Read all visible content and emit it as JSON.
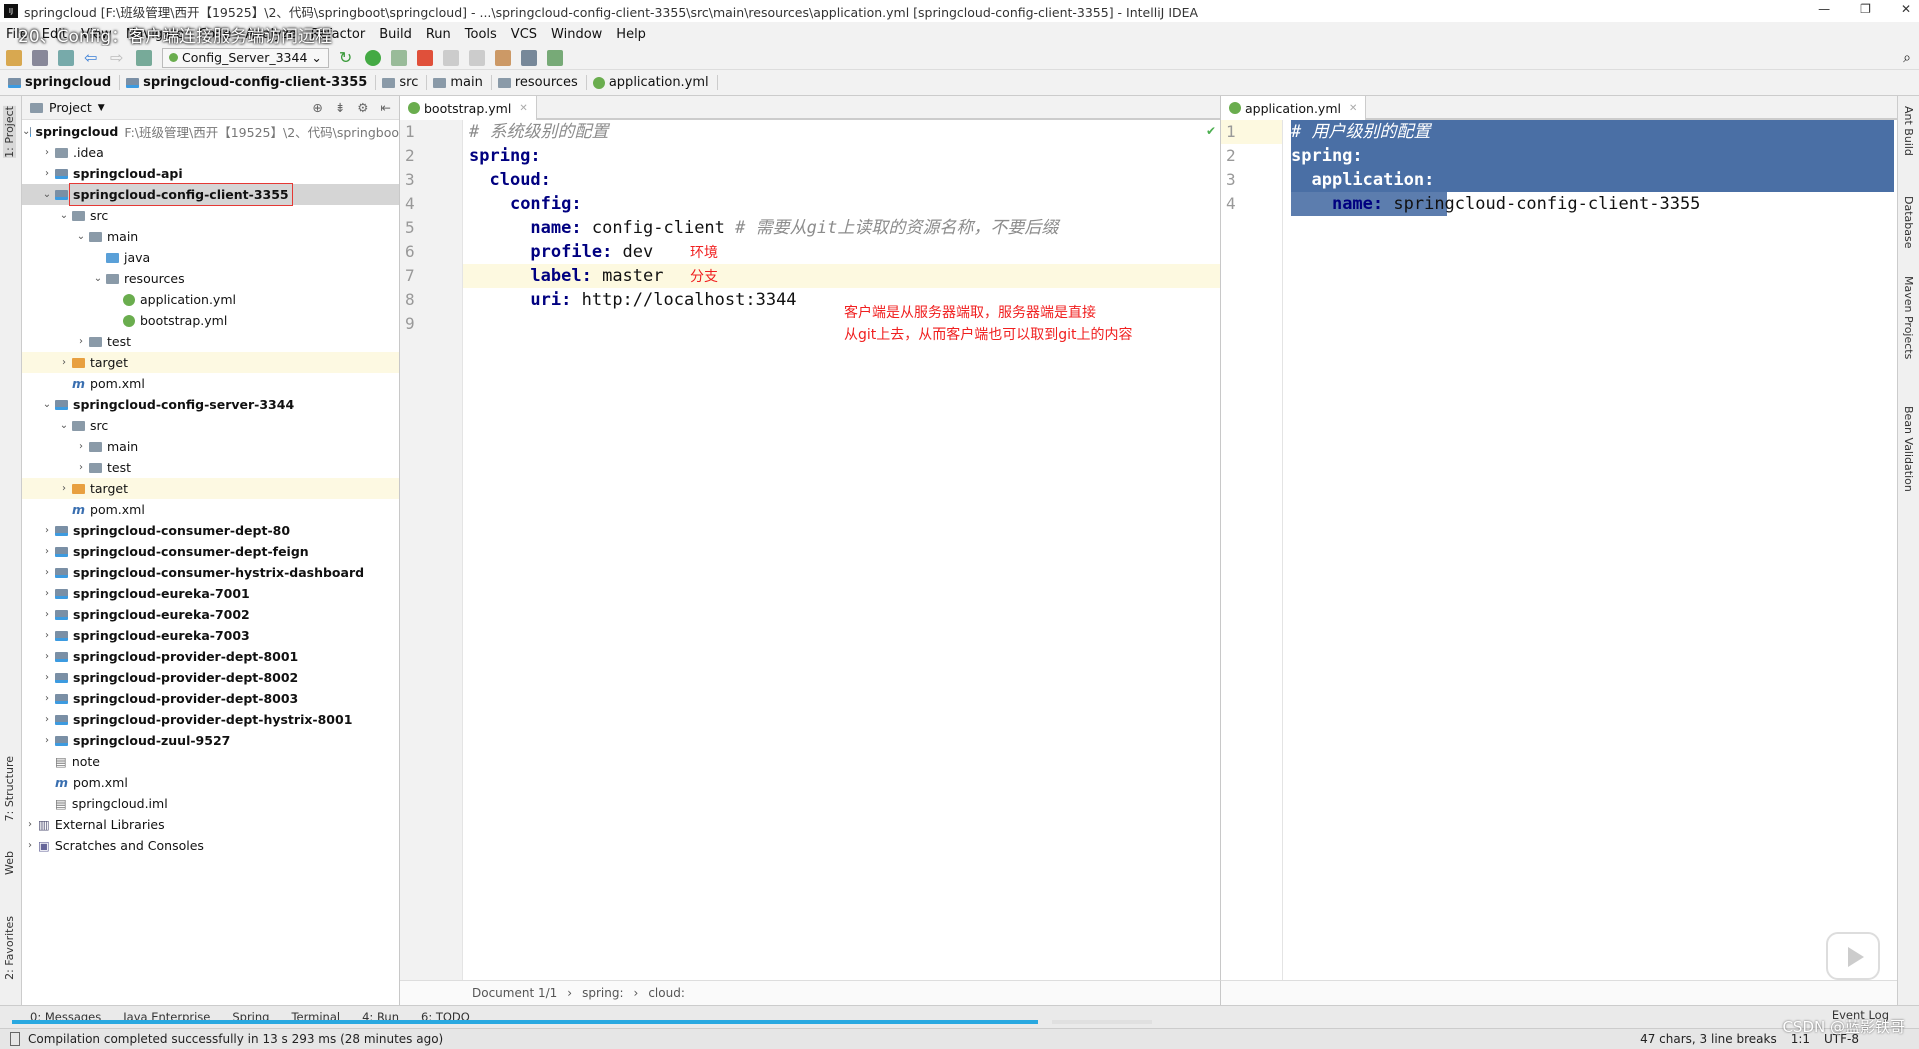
{
  "window": {
    "title": "springcloud [F:\\班级管理\\西开【19525】\\2、代码\\springboot\\springcloud] - ...\\springcloud-config-client-3355\\src\\main\\resources\\application.yml [springcloud-config-client-3355] - IntelliJ IDEA"
  },
  "video_title": "20、Config：客户端连接服务端访问远程",
  "menu": [
    "File",
    "Edit",
    "View",
    "Navigate",
    "Code",
    "Analyze",
    "Refactor",
    "Build",
    "Run",
    "Tools",
    "VCS",
    "Window",
    "Help"
  ],
  "toolbar": {
    "run_config": "Config_Server_3344"
  },
  "breadcrumb": [
    "springcloud",
    "springcloud-config-client-3355",
    "src",
    "main",
    "resources",
    "application.yml"
  ],
  "left_strip": [
    "1: Project",
    "7: Structure",
    "Web",
    "2: Favorites"
  ],
  "right_strip": [
    "Ant Build",
    "Database",
    "Maven Projects",
    "Bean Validation"
  ],
  "project": {
    "header": "Project",
    "tree": [
      {
        "d": 0,
        "label": "springcloud",
        "path": "F:\\班级管理\\西开【19525】\\2、代码\\springboo",
        "exp": true,
        "bold": true,
        "icon": "module"
      },
      {
        "d": 1,
        "label": ".idea",
        "icon": "folder"
      },
      {
        "d": 1,
        "label": "springcloud-api",
        "bold": true,
        "icon": "module"
      },
      {
        "d": 1,
        "label": "springcloud-config-client-3355",
        "bold": true,
        "exp": true,
        "icon": "module",
        "selected": true,
        "boxed": true
      },
      {
        "d": 2,
        "label": "src",
        "exp": true,
        "icon": "folder"
      },
      {
        "d": 3,
        "label": "main",
        "exp": true,
        "icon": "folder"
      },
      {
        "d": 4,
        "label": "java",
        "icon": "folder-blue",
        "leaf": true
      },
      {
        "d": 4,
        "label": "resources",
        "exp": true,
        "icon": "folder"
      },
      {
        "d": 5,
        "label": "application.yml",
        "icon": "yml",
        "leaf": true
      },
      {
        "d": 5,
        "label": "bootstrap.yml",
        "icon": "yml",
        "leaf": true
      },
      {
        "d": 3,
        "label": "test",
        "icon": "folder"
      },
      {
        "d": 2,
        "label": "target",
        "icon": "folder-orange",
        "hl": true
      },
      {
        "d": 2,
        "label": "pom.xml",
        "icon": "maven",
        "leaf": true
      },
      {
        "d": 1,
        "label": "springcloud-config-server-3344",
        "bold": true,
        "exp": true,
        "icon": "module"
      },
      {
        "d": 2,
        "label": "src",
        "exp": true,
        "icon": "folder"
      },
      {
        "d": 3,
        "label": "main",
        "icon": "folder"
      },
      {
        "d": 3,
        "label": "test",
        "icon": "folder"
      },
      {
        "d": 2,
        "label": "target",
        "icon": "folder-orange",
        "hl": true
      },
      {
        "d": 2,
        "label": "pom.xml",
        "icon": "maven",
        "leaf": true
      },
      {
        "d": 1,
        "label": "springcloud-consumer-dept-80",
        "bold": true,
        "icon": "module"
      },
      {
        "d": 1,
        "label": "springcloud-consumer-dept-feign",
        "bold": true,
        "icon": "module"
      },
      {
        "d": 1,
        "label": "springcloud-consumer-hystrix-dashboard",
        "bold": true,
        "icon": "module"
      },
      {
        "d": 1,
        "label": "springcloud-eureka-7001",
        "bold": true,
        "icon": "module"
      },
      {
        "d": 1,
        "label": "springcloud-eureka-7002",
        "bold": true,
        "icon": "module"
      },
      {
        "d": 1,
        "label": "springcloud-eureka-7003",
        "bold": true,
        "icon": "module"
      },
      {
        "d": 1,
        "label": "springcloud-provider-dept-8001",
        "bold": true,
        "icon": "module"
      },
      {
        "d": 1,
        "label": "springcloud-provider-dept-8002",
        "bold": true,
        "icon": "module"
      },
      {
        "d": 1,
        "label": "springcloud-provider-dept-8003",
        "bold": true,
        "icon": "module"
      },
      {
        "d": 1,
        "label": "springcloud-provider-dept-hystrix-8001",
        "bold": true,
        "icon": "module"
      },
      {
        "d": 1,
        "label": "springcloud-zuul-9527",
        "bold": true,
        "icon": "module"
      },
      {
        "d": 1,
        "label": "note",
        "icon": "file",
        "leaf": true
      },
      {
        "d": 1,
        "label": "pom.xml",
        "icon": "maven",
        "leaf": true
      },
      {
        "d": 1,
        "label": "springcloud.iml",
        "icon": "file",
        "leaf": true
      },
      {
        "d": 0,
        "label": "External Libraries",
        "icon": "lib"
      },
      {
        "d": 0,
        "label": "Scratches and Consoles",
        "icon": "scratch"
      }
    ]
  },
  "editor_left": {
    "tab": "bootstrap.yml",
    "lines": [
      [
        [
          "c",
          "# 系统级别的配置"
        ]
      ],
      [
        [
          "k",
          "spring:"
        ]
      ],
      [
        [
          "v",
          "  "
        ],
        [
          "k",
          "cloud:"
        ]
      ],
      [
        [
          "v",
          "    "
        ],
        [
          "k",
          "config:"
        ]
      ],
      [
        [
          "v",
          "      "
        ],
        [
          "k",
          "name: "
        ],
        [
          "v",
          "config-client "
        ],
        [
          "c",
          "# 需要从git上读取的资源名称，不要后缀"
        ]
      ],
      [
        [
          "v",
          "      "
        ],
        [
          "k",
          "profile: "
        ],
        [
          "v",
          "dev"
        ]
      ],
      [
        [
          "v",
          "      "
        ],
        [
          "k",
          "label: "
        ],
        [
          "v",
          "master"
        ]
      ],
      [
        [
          "v",
          "      "
        ],
        [
          "k",
          "uri: "
        ],
        [
          "v",
          "http://localhost:3344"
        ]
      ],
      []
    ],
    "annotations": {
      "profile": "环境",
      "label": "分支",
      "note_line1": "客户端是从服务器端取，服务器端是直接",
      "note_line2": "从git上去，从而客户端也可以取到git上的内容"
    },
    "crumbs": [
      "Document 1/1",
      "spring:",
      "cloud:"
    ]
  },
  "editor_right": {
    "tab": "application.yml",
    "lines": [
      [
        [
          "c",
          "# 用户级别的配置"
        ]
      ],
      [
        [
          "k",
          "spring:"
        ]
      ],
      [
        [
          "v",
          "  "
        ],
        [
          "k",
          "application:"
        ]
      ],
      [
        [
          "v",
          "    "
        ],
        [
          "k",
          "name: "
        ],
        [
          "v",
          "springcloud-config-client-3355"
        ]
      ]
    ]
  },
  "toolwindows": [
    "0: Messages",
    "Java Enterprise",
    "Spring",
    "Terminal",
    "4: Run",
    "6: TODO"
  ],
  "event_log": "Event Log",
  "progress": 0.9,
  "status": {
    "message": "Compilation completed successfully in 13 s 293 ms (28 minutes ago)",
    "chars": "47 chars, 3 line breaks",
    "pos": "1:1",
    "encoding": "UTF-8"
  },
  "watermark": "CSDN @蓝影铁哥"
}
